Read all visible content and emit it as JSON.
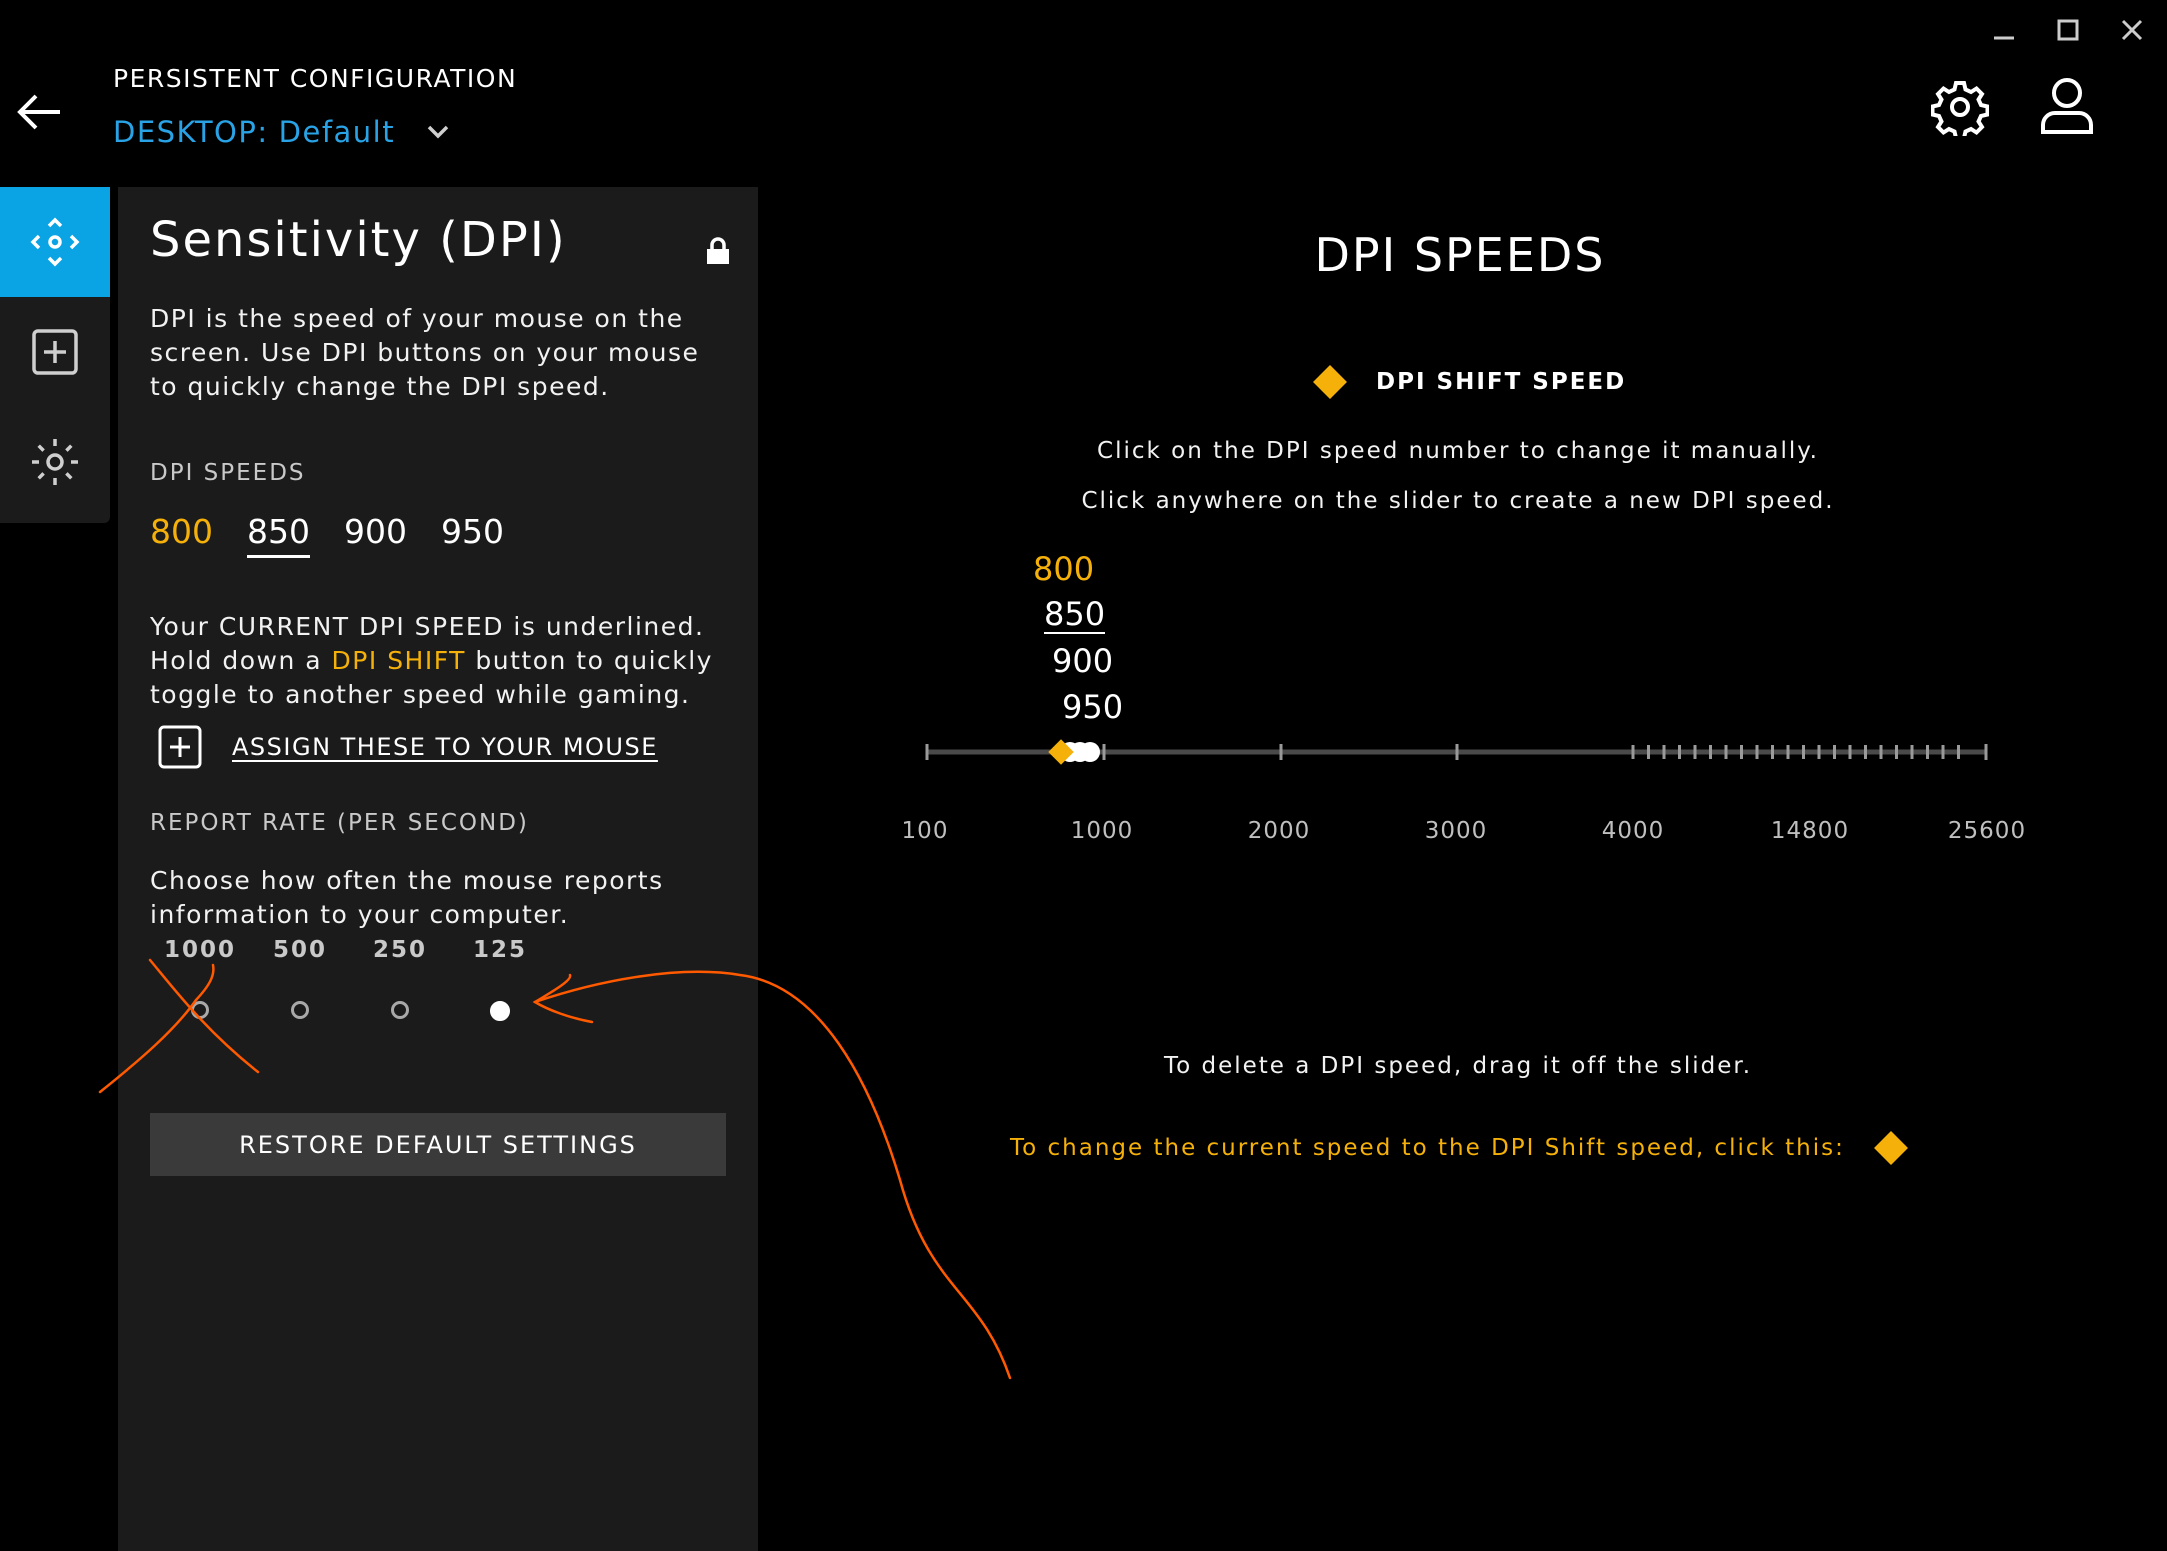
{
  "window": {
    "minimize_icon": "minimize-icon",
    "maximize_icon": "maximize-icon",
    "close_icon": "close-icon"
  },
  "header": {
    "config_mode": "PERSISTENT CONFIGURATION",
    "profile_prefix": "DESKTOP:",
    "profile_name": "Default"
  },
  "nav": {
    "items": [
      "dpi-icon",
      "plus-box-icon",
      "lighting-icon"
    ],
    "active": 0
  },
  "panel": {
    "title": "Sensitivity (DPI)",
    "description": "DPI is the speed of your mouse on the screen. Use DPI buttons on your mouse to quickly change the DPI speed.",
    "dpi_speeds_label": "DPI SPEEDS",
    "dpi_speeds": [
      "800",
      "850",
      "900",
      "950"
    ],
    "shift_speed": "800",
    "current_speed": "850",
    "current_text_1": "Your CURRENT DPI SPEED is underlined.",
    "current_text_2a": "Hold down a",
    "current_text_2b": "DPI SHIFT",
    "current_text_2c": "button to quickly",
    "current_text_3": "toggle to another speed while gaming.",
    "assign_label": "ASSIGN THESE TO YOUR MOUSE",
    "report_rate_label": "REPORT RATE (PER SECOND)",
    "report_rate_desc": "Choose how often the mouse reports information to your computer.",
    "report_rates": [
      "1000",
      "500",
      "250",
      "125"
    ],
    "selected_rate": "125",
    "restore_label": "RESTORE DEFAULT SETTINGS"
  },
  "right": {
    "title": "DPI SPEEDS",
    "shift_legend": "DPI SHIFT SPEED",
    "instruction_1": "Click on the DPI speed number to change it manually.",
    "instruction_2": "Click anywhere on the slider to create a new DPI speed.",
    "tick_labels": [
      "100",
      "1000",
      "2000",
      "3000",
      "4000",
      "14800",
      "25600"
    ],
    "delete_text": "To delete a DPI speed, drag it off the slider.",
    "change_text": "To change the current speed to the DPI Shift speed, click this:"
  },
  "colors": {
    "accent_blue": "#0aa3e4",
    "profile_blue": "#29a3e6",
    "shift_yellow": "#f5b10a",
    "annotation": "#ff5a00"
  }
}
